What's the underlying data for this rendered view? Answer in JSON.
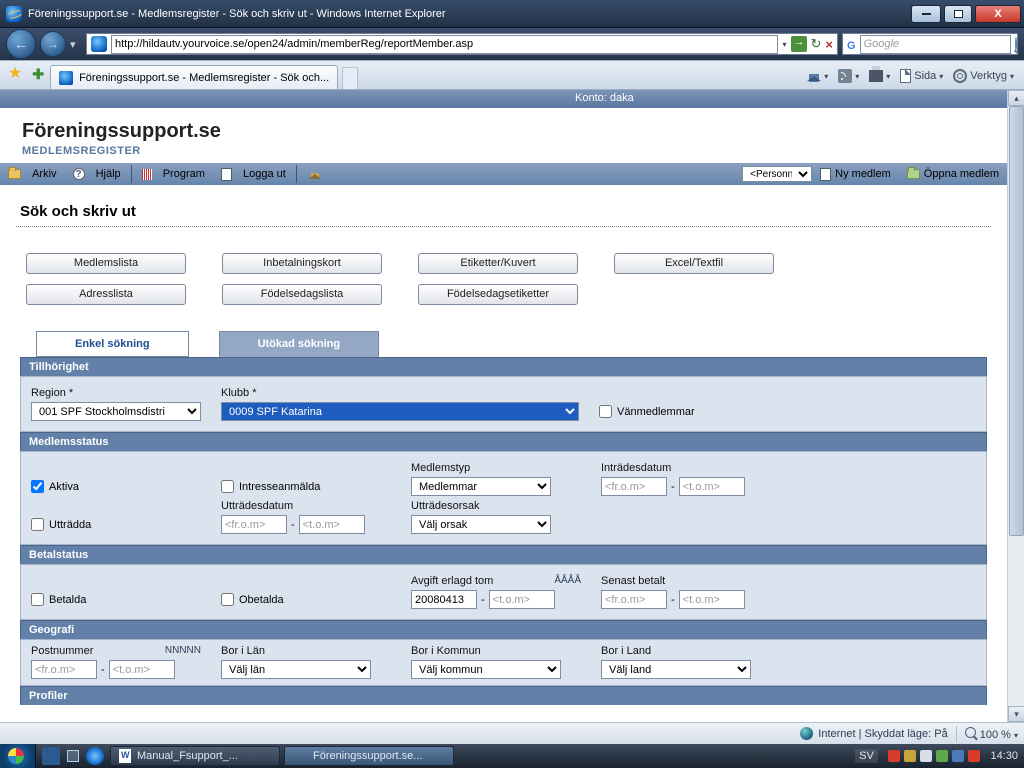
{
  "window": {
    "title": "Föreningssupport.se - Medlemsregister - Sök och skriv ut - Windows Internet Explorer"
  },
  "nav": {
    "url": "http://hildautv.yourvoice.se/open24/admin/memberReg/reportMember.asp",
    "search_placeholder": "Google"
  },
  "browser_tab": "Föreningssupport.se - Medlemsregister - Sök och...",
  "command_bar": {
    "sida": "Sida",
    "verktyg": "Verktyg"
  },
  "account_bar": "Konto: daka",
  "logo": {
    "name": "Föreningssupport.se",
    "sub": "MEDLEMSREGISTER"
  },
  "menu": {
    "arkiv": "Arkiv",
    "hjalp": "Hjälp",
    "program": "Program",
    "logga_ut": "Logga ut",
    "personnr": "<Personnr.>",
    "ny_medlem": "Ny medlem",
    "oppna_medlem": "Öppna medlem"
  },
  "page_title": "Sök och skriv ut",
  "buttons": {
    "medlemslista": "Medlemslista",
    "inbetalningskort": "Inbetalningskort",
    "etiketter": "Etiketter/Kuvert",
    "excel": "Excel/Textfil",
    "adresslista": "Adresslista",
    "fodelsedagslista": "Födelsedagslista",
    "fodelsedagsetiketter": "Födelsedagsetiketter"
  },
  "tabs": {
    "enkel": "Enkel sökning",
    "utokad": "Utökad sökning"
  },
  "section": {
    "tillhorighet": "Tillhörighet",
    "medlemsstatus": "Medlemsstatus",
    "betalstatus": "Betalstatus",
    "geografi": "Geografi",
    "profiler": "Profiler"
  },
  "form": {
    "region_label": "Region *",
    "region_value": "001 SPF Stockholmsdistri",
    "klubb_label": "Klubb *",
    "klubb_value": "0009 SPF Katarina",
    "vanmedlemmar": "Vänmedlemmar",
    "aktiva": "Aktiva",
    "intresseanmalda": "Intresseanmälda",
    "uttradda": "Utträdda",
    "medlemstyp_label": "Medlemstyp",
    "medlemstyp_value": "Medlemmar",
    "intradesdatum": "Inträdesdatum",
    "uttradesdatum": "Utträdesdatum",
    "uttradesorsak_label": "Utträdesorsak",
    "uttradesorsak_value": "Välj orsak",
    "from": "<fr.o.m>",
    "tom": "<t.o.m>",
    "betalda": "Betalda",
    "obetalda": "Obetalda",
    "avgift_label": "Avgift erlagd tom",
    "avgift_hint": "ÅÅÅÅ",
    "avgift_value": "20080413",
    "senast_betalt": "Senast betalt",
    "postnummer": "Postnummer",
    "nnnnn": "NNNNN",
    "bor_lan_label": "Bor i Län",
    "bor_lan_value": "Välj län",
    "bor_kommun_label": "Bor i Kommun",
    "bor_kommun_value": "Välj kommun",
    "bor_land_label": "Bor i Land",
    "bor_land_value": "Välj land"
  },
  "iestatus": {
    "zone": "Internet | Skyddat läge: På",
    "zoom": "100 %"
  },
  "taskbar": {
    "task1": "Manual_Fsupport_...",
    "task2": "Föreningssupport.se...",
    "lang": "SV",
    "time": "14:30"
  }
}
